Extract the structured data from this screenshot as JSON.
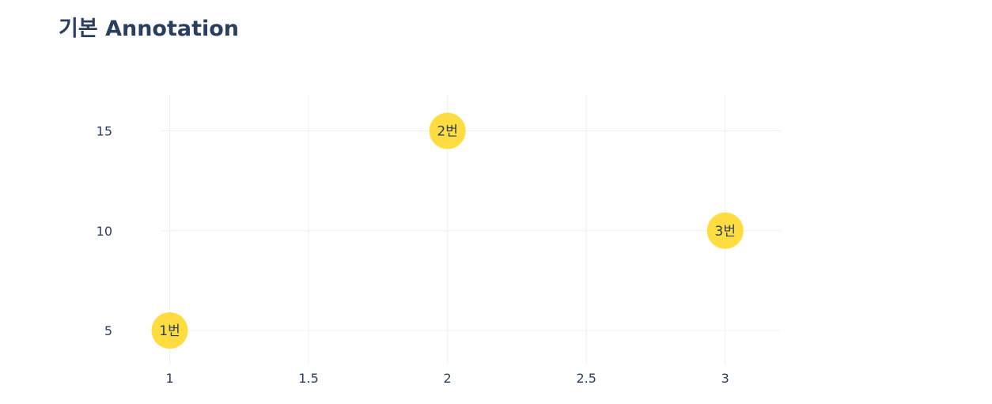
{
  "chart_data": {
    "type": "scatter",
    "title": "기본 Annotation",
    "xlabel": "",
    "ylabel": "",
    "x": [
      1,
      2,
      3
    ],
    "y": [
      5,
      15,
      10
    ],
    "point_labels": [
      "1번",
      "2번",
      "3번"
    ],
    "xlim": [
      0.97,
      3.2
    ],
    "ylim": [
      3.3,
      16.8
    ],
    "xticks": [
      1,
      1.5,
      2,
      2.5,
      3
    ],
    "xtick_labels": [
      "1",
      "1.5",
      "2",
      "2.5",
      "3"
    ],
    "yticks": [
      5,
      10,
      15
    ],
    "ytick_labels": [
      "5",
      "10",
      "15"
    ],
    "grid": true,
    "legend": "none",
    "colors": {
      "marker": "#ffdc3f",
      "grid": "#ebf0f8",
      "text": "#2a3f5f"
    }
  }
}
